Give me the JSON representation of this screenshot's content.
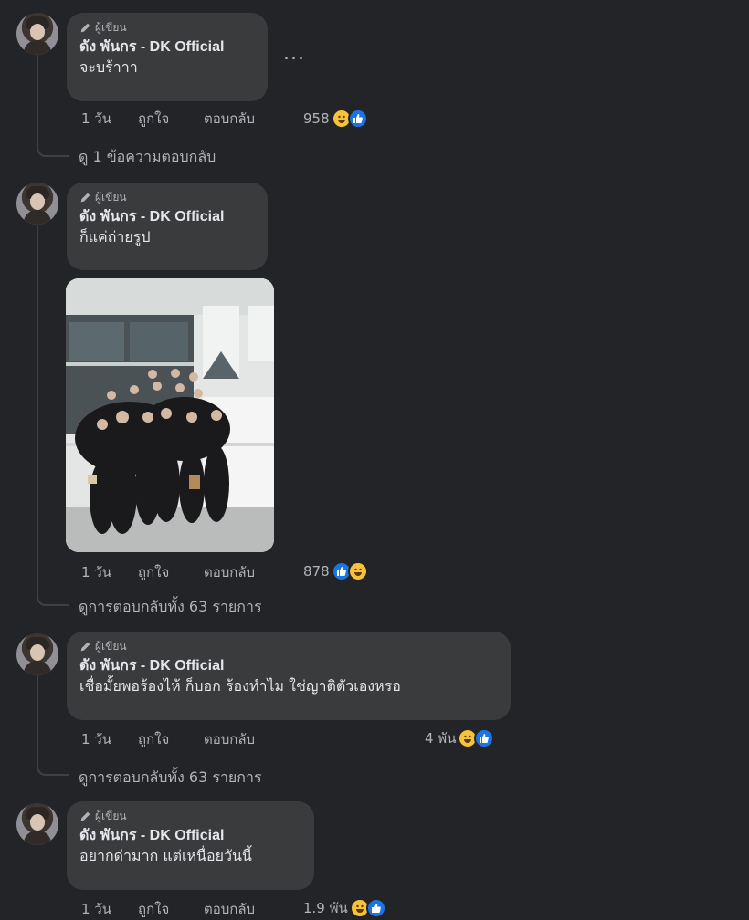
{
  "comments": [
    {
      "author_badge": "ผู้เขียน",
      "author": "ดัง พันกร - DK Official",
      "text": "จะบร้าาา",
      "time": "1 วัน",
      "like": "ถูกใจ",
      "reply": "ตอบกลับ",
      "reaction_count": "958",
      "reactions": [
        "haha-emoji-icon",
        "like-emoji-icon"
      ],
      "view_replies": "ดู 1 ข้อความตอบกลับ",
      "more": "..."
    },
    {
      "author_badge": "ผู้เขียน",
      "author": "ดัง พันกร - DK Official",
      "text": "ก็แค่ถ่ายรูป",
      "time": "1 วัน",
      "like": "ถูกใจ",
      "reply": "ตอบกลับ",
      "reaction_count": "878",
      "reactions": [
        "like-emoji-icon",
        "haha-emoji-icon"
      ],
      "view_replies": "ดูการตอบกลับทั้ง 63 รายการ",
      "photo": "group-photo-people-in-black"
    },
    {
      "author_badge": "ผู้เขียน",
      "author": "ดัง พันกร - DK Official",
      "text": "เชื่อมั้ยพอร้องไห้ ก็บอก ร้องทำไม ใช่ญาติตัวเองหรอ",
      "time": "1 วัน",
      "like": "ถูกใจ",
      "reply": "ตอบกลับ",
      "reaction_count": "4 พัน",
      "reactions": [
        "haha-emoji-icon",
        "like-emoji-icon"
      ],
      "view_replies": "ดูการตอบกลับทั้ง 63 รายการ"
    },
    {
      "author_badge": "ผู้เขียน",
      "author": "ดัง พันกร - DK Official",
      "text": "อยากด่ามาก แต่เหนื่อยวันนี้",
      "time": "1 วัน",
      "like": "ถูกใจ",
      "reply": "ตอบกลับ",
      "reaction_count": "1.9 พัน",
      "reactions": [
        "haha-emoji-icon",
        "like-emoji-icon"
      ]
    }
  ],
  "colors": {
    "background": "#232427",
    "bubble": "#3a3b3c",
    "primary_text": "#e4e6eb",
    "secondary_text": "#b0b3b8",
    "like_blue": "#1b74e4",
    "haha_yellow": "#f7c23b"
  }
}
